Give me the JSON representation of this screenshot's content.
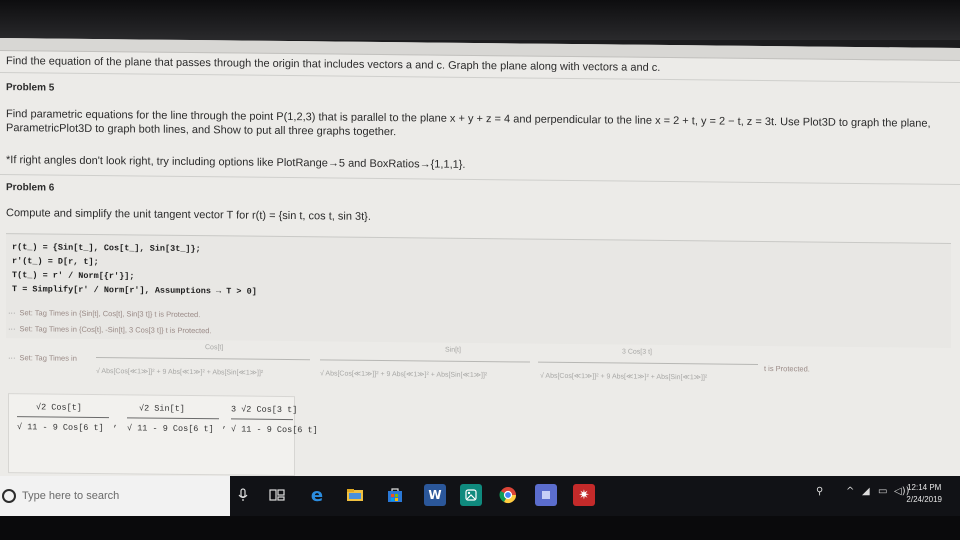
{
  "document": {
    "line_find_plane": "Find the equation of the plane that passes through the origin that includes vectors a and c. Graph the plane along with vectors a and c.",
    "problem5_heading": "Problem 5",
    "problem5_line1": "Find parametric equations for the line through the point P(1,2,3) that is parallel to the plane x + y + z = 4 and perpendicular to the line x = 2 + t, y = 2 − t, z = 3t. Use Plot3D to graph the plane,",
    "problem5_line2": "ParametricPlot3D to graph both lines, and Show to put all three graphs together.",
    "hint_line": "*If right angles don't look right, try including options like PlotRange→5 and BoxRatios→{1,1,1}.",
    "problem6_heading": "Problem 6",
    "problem6_line": "Compute and simplify the unit tangent vector T for r(t) = {sin t, cos t, sin 3t}."
  },
  "code": {
    "line1": "r(t_) = {Sin[t_], Cos[t_], Sin[3t_]};",
    "line2": "r'(t_) = D[r, t];",
    "line3": "T(t_) = r' / Norm[{r'}];",
    "line4": "T = Simplify[r' / Norm[r'], Assumptions → T > 0]"
  },
  "messages": {
    "dots": "···",
    "msg1": "Set: Tag Times in {Sin[t], Cos[t], Sin[3 t]} t  is Protected.",
    "msg2": "Set: Tag Times in {Cos[t], -Sin[t], 3 Cos[3 t]} t  is Protected.",
    "msg3_prefix": "Set: Tag Times in",
    "msg3_num1": "Cos[t]",
    "msg3_num2": "Sin[t]",
    "msg3_num3": "3 Cos[3 t]",
    "msg3_suffix": "t  is Protected.",
    "msg3_den1": "√ Abs[Cos[≪1≫]]² + 9 Abs[≪1≫]² + Abs[Sin[≪1≫]]²",
    "msg3_den2": "√ Abs[Cos[≪1≫]]² + 9 Abs[≪1≫]² + Abs[Sin[≪1≫]]²",
    "msg3_den3": "√ Abs[Cos[≪1≫]]² + 9 Abs[≪1≫]² + Abs[Sin[≪1≫]]²"
  },
  "output": {
    "num1": "√2 Cos[t]",
    "num2": "√2 Sin[t]",
    "num3": "3 √2 Cos[3 t]",
    "den1": "√ 11 - 9 Cos[6 t]",
    "den2": "√ 11 - 9 Cos[6 t]",
    "den3": "√ 11 - 9 Cos[6 t]",
    "comma": ","
  },
  "zoom": "100",
  "taskbar": {
    "search_placeholder": "Type here to search",
    "time": "12:14 PM",
    "date": "2/24/2019"
  },
  "colors": {
    "screen_bg": "#ecebe8",
    "taskbar_bg": "#111216",
    "edge_blue": "#1e6fd0",
    "store_blue": "#2a78d6"
  },
  "icons": [
    "search-icon",
    "microphone-icon",
    "task-view-icon",
    "edge-icon",
    "file-explorer-icon",
    "store-icon",
    "word-icon",
    "photos-icon",
    "chrome-icon",
    "app-icon",
    "settings-gear-icon",
    "people-icon",
    "chevron-up-icon",
    "network-icon",
    "battery-icon",
    "volume-icon"
  ]
}
